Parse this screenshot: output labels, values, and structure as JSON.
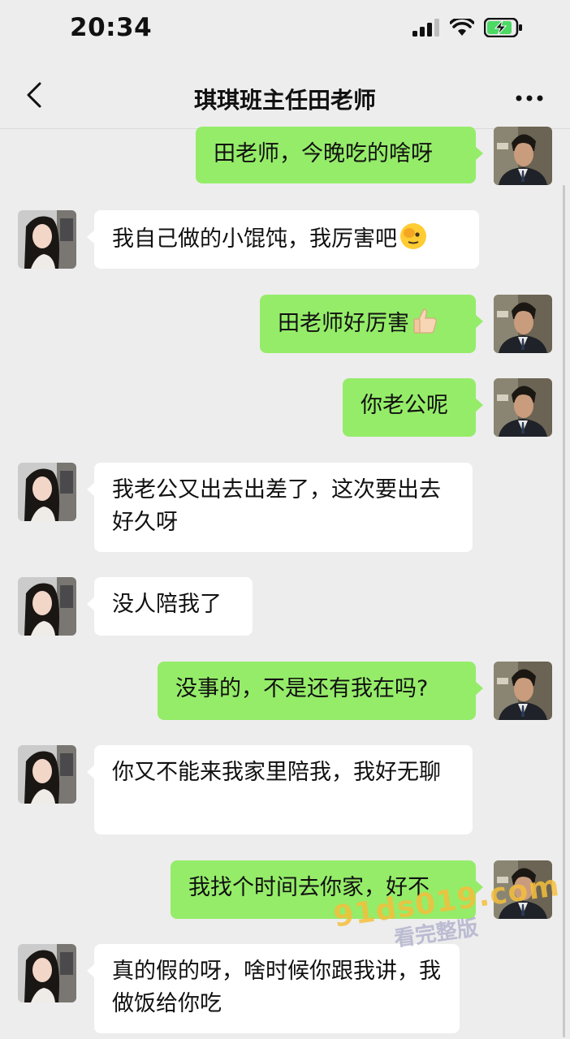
{
  "status": {
    "time": "20:34"
  },
  "header": {
    "title": "琪琪班主任田老师"
  },
  "messages": [
    {
      "from": "me",
      "text": "田老师，今晚吃的啥呀"
    },
    {
      "from": "other",
      "text": "我自己做的小馄饨，我厉害吧"
    },
    {
      "from": "me",
      "text": "田老师好厉害"
    },
    {
      "from": "me",
      "text": "你老公呢"
    },
    {
      "from": "other",
      "text": "我老公又出去出差了，这次要出去好久呀"
    },
    {
      "from": "other",
      "text": "没人陪我了"
    },
    {
      "from": "me",
      "text": "没事的，不是还有我在吗?"
    },
    {
      "from": "other",
      "text": "你又不能来我家里陪我，我好无聊"
    },
    {
      "from": "me",
      "text": "我找个时间去你家，好不"
    },
    {
      "from": "other",
      "text": "真的假的呀，啥时候你跟我讲，我做饭给你吃"
    }
  ],
  "watermark": {
    "url": "91ds019.com",
    "text": "看完整版"
  },
  "icons": {
    "back": "chevron-left-icon",
    "more": "more-dots-icon",
    "signal": "signal-icon",
    "wifi": "wifi-icon",
    "battery": "battery-charging-icon",
    "emoji_salute": "salute-emoji",
    "emoji_thumbs": "thumbs-up-emoji"
  },
  "colors": {
    "sent_bubble": "#95ec69",
    "recv_bubble": "#ffffff",
    "background": "#ededed"
  }
}
